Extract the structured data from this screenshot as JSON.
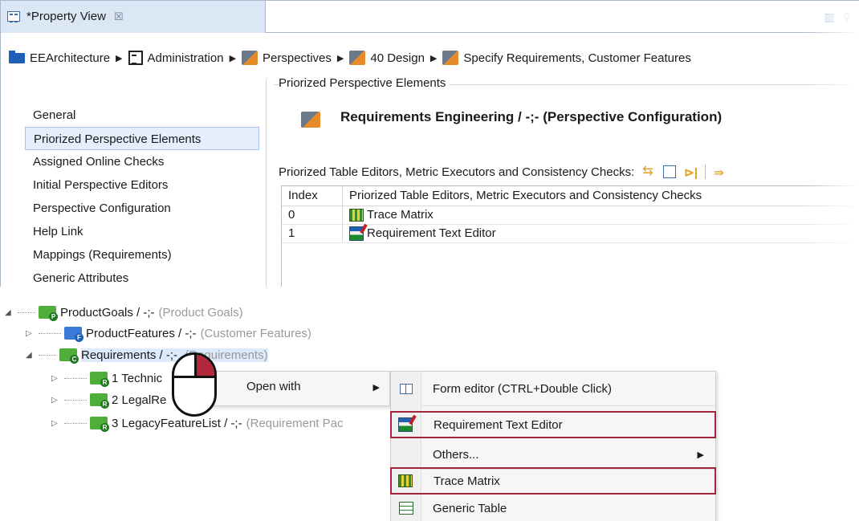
{
  "view": {
    "title": "*Property View",
    "close_glyph": "☒"
  },
  "breadcrumb": [
    {
      "label": "EEArchitecture",
      "icon": "folder-icon"
    },
    {
      "label": "Administration",
      "icon": "administration-icon"
    },
    {
      "label": "Perspectives",
      "icon": "perspective-icon"
    },
    {
      "label": "40 Design",
      "icon": "perspective-icon"
    },
    {
      "label": "Specify Requirements, Customer Features",
      "icon": "perspective-icon"
    }
  ],
  "nav": {
    "items": [
      "General",
      "Priorized Perspective Elements",
      "Assigned Online Checks",
      "Initial Perspective Editors",
      "Perspective Configuration",
      "Help Link",
      "Mappings (Requirements)",
      "Generic Attributes"
    ],
    "selected": "Priorized Perspective Elements"
  },
  "group": {
    "legend": "Priorized Perspective Elements",
    "config_title": "Requirements Engineering / -;- (Perspective Configuration)"
  },
  "table": {
    "caption": "Priorized Table Editors, Metric Executors and Consistency Checks:",
    "columns": [
      "Index",
      "Priorized Table Editors, Metric Executors and Consistency Checks"
    ],
    "rows": [
      {
        "index": "0",
        "name": "Trace Matrix",
        "icon": "trace-matrix-icon"
      },
      {
        "index": "1",
        "name": "Requirement Text Editor",
        "icon": "requirement-text-editor-icon"
      }
    ]
  },
  "tree": [
    {
      "label": "ProductGoals / -;-",
      "type": "(Product Goals)",
      "badge": "P",
      "expanded": true
    },
    {
      "label": "ProductFeatures / -;-",
      "type": "(Customer Features)",
      "badge": "F",
      "expanded": false
    },
    {
      "label": "Requirements / -;-",
      "type": "(Requirements)",
      "badge": "C",
      "expanded": true
    },
    {
      "label": "1 Technic",
      "type": "",
      "badge": "R",
      "expanded": false
    },
    {
      "label": "2 LegalRe",
      "type": "",
      "badge": "R",
      "expanded": false
    },
    {
      "label": "3 LegacyFeatureList / -;-",
      "type": "(Requirement Pac",
      "badge": "R",
      "expanded": false
    }
  ],
  "context_menu": {
    "item": "Open with"
  },
  "submenu": [
    {
      "label": "Form editor (CTRL+Double Click)",
      "icon": "form-editor-icon",
      "highlighted": false
    },
    {
      "label": "Requirement Text Editor",
      "icon": "requirement-text-editor-icon",
      "highlighted": true
    },
    {
      "label": "Others...",
      "icon": "",
      "highlighted": false,
      "has_submenu": true
    },
    {
      "label": "Trace Matrix",
      "icon": "trace-matrix-icon",
      "highlighted": true
    },
    {
      "label": "Generic Table",
      "icon": "generic-table-icon",
      "highlighted": false
    }
  ],
  "colors": {
    "highlight_border": "#a3253b",
    "selection": "#e4eefc",
    "tab_background": "#dce7f6"
  }
}
